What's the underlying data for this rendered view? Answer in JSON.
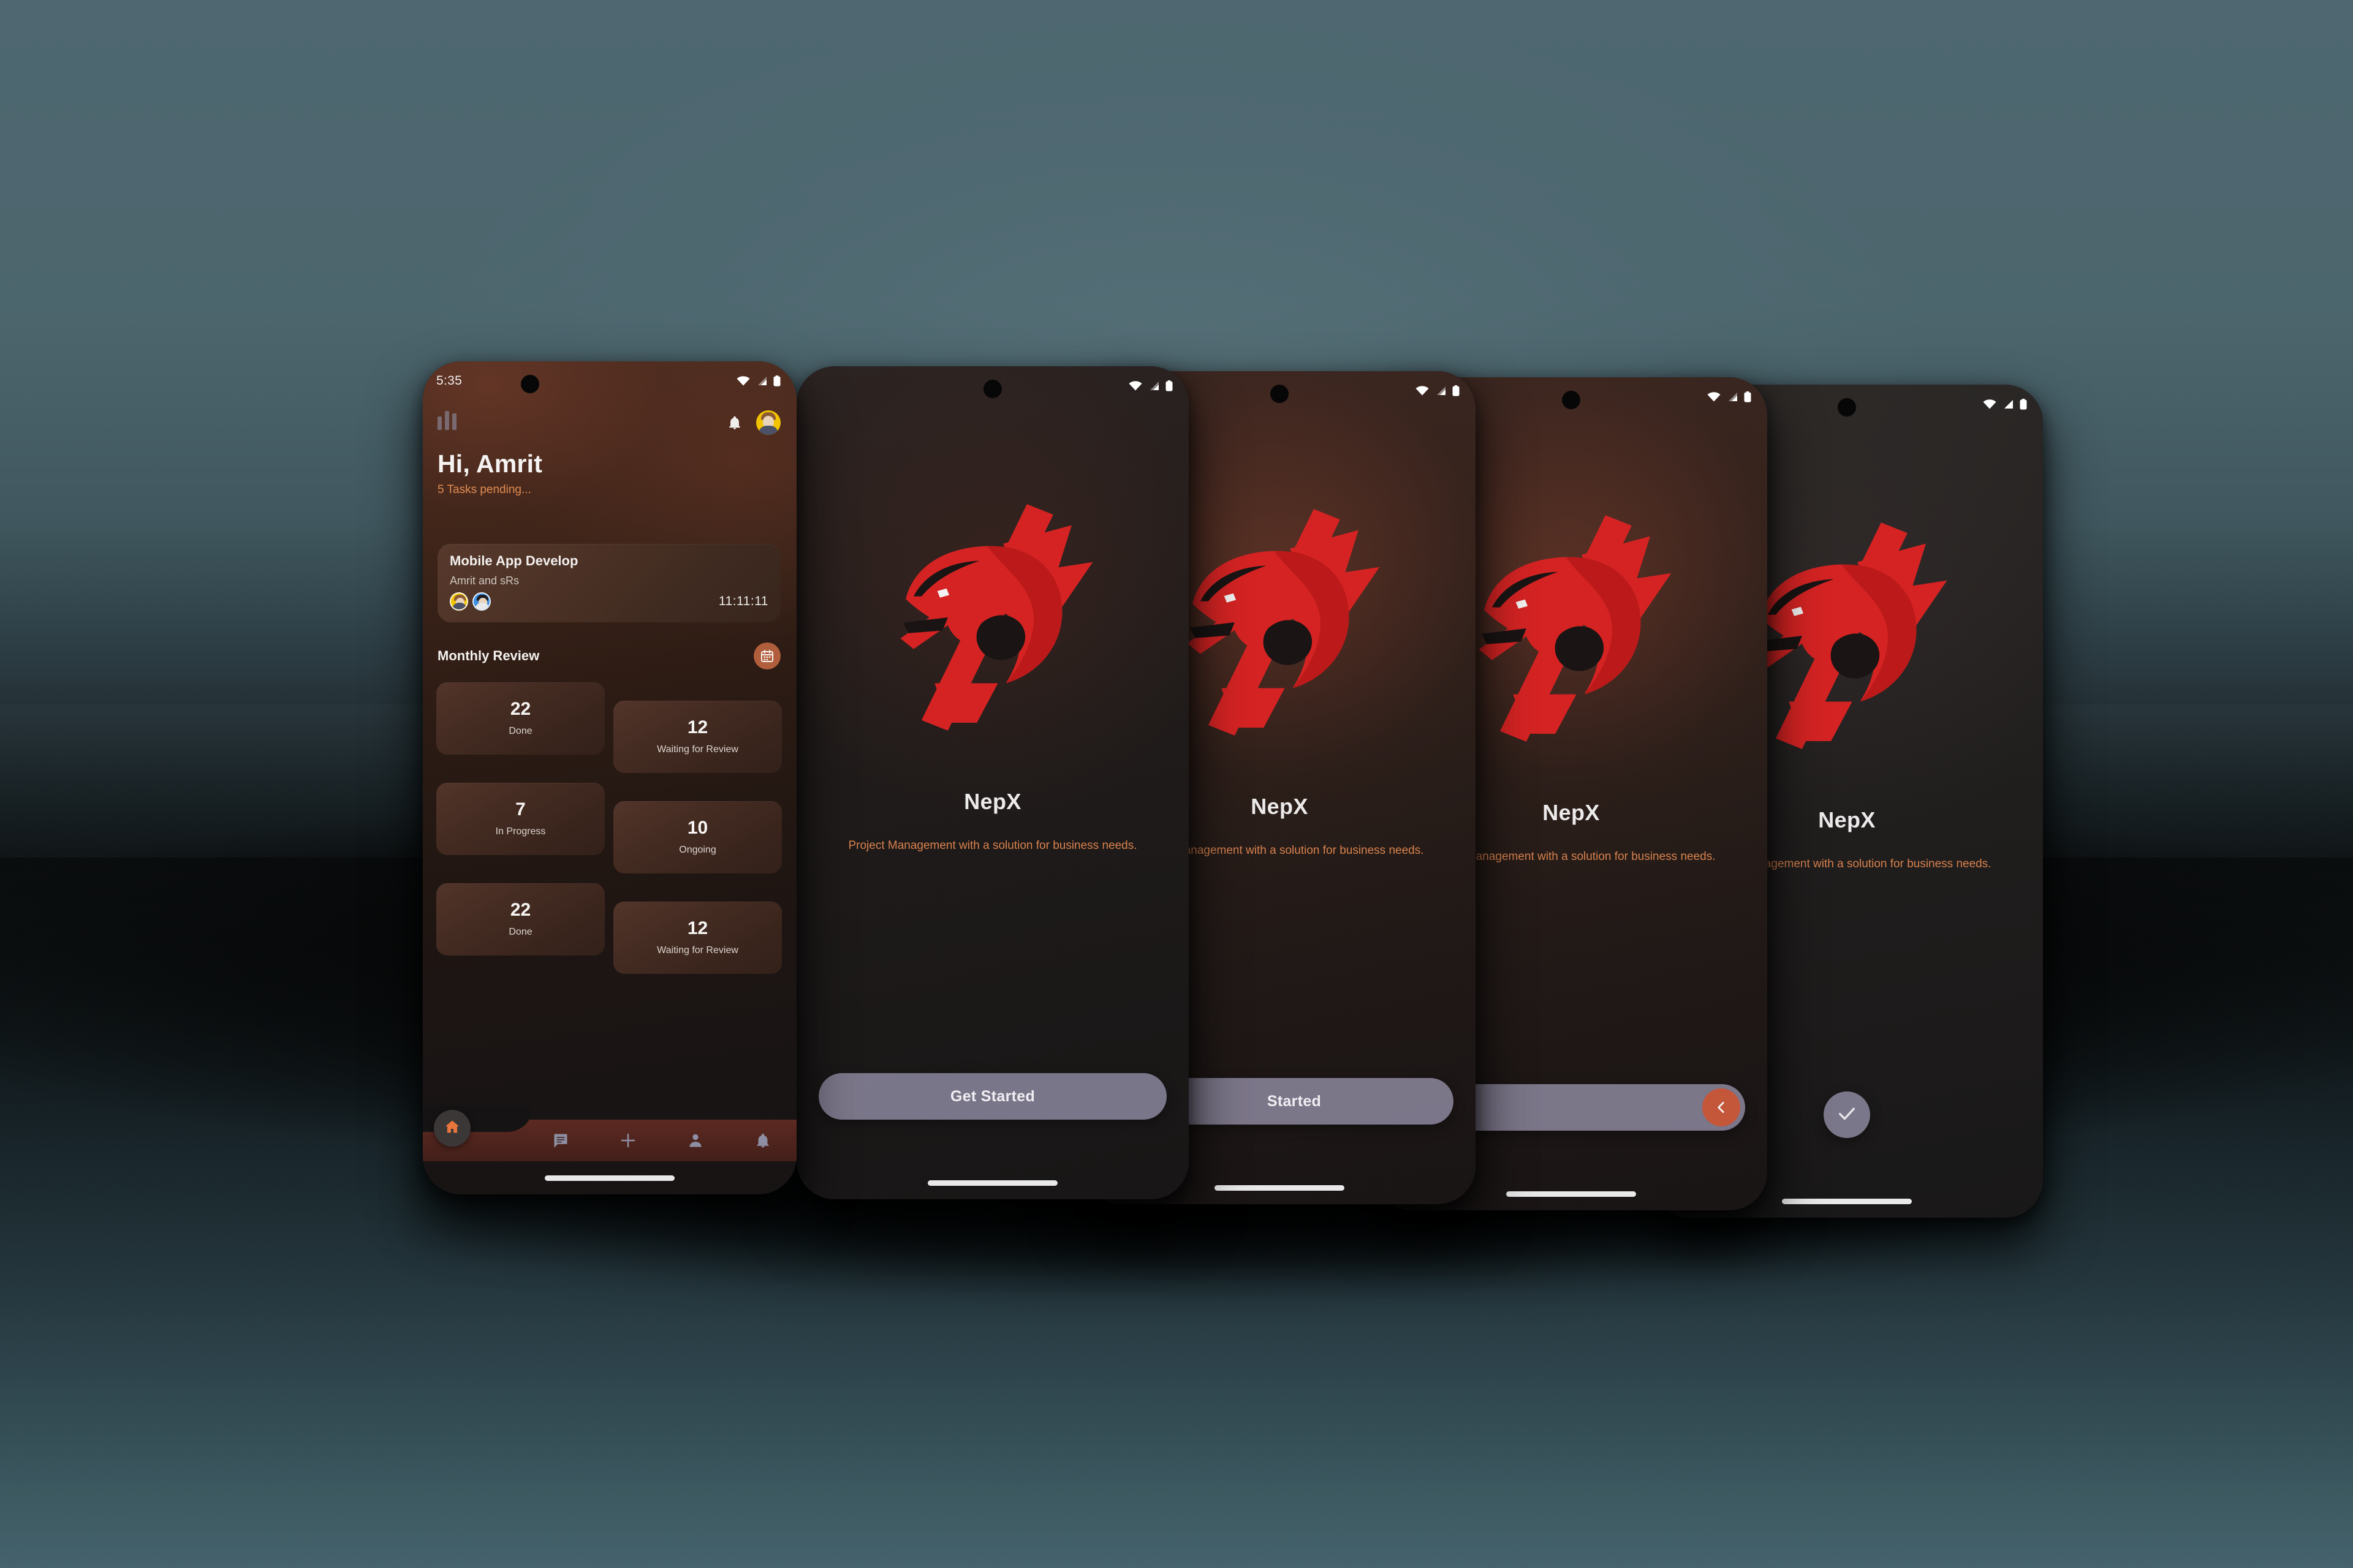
{
  "background": {
    "sky_color": "#4c666e",
    "floor_color": "#3b5860",
    "accent_orange": "#c4563a",
    "brand_red": "#d62121"
  },
  "phones": [
    {
      "id": "dashboard",
      "status": {
        "time": "5:35",
        "wifi_icon": "wifi-icon",
        "signal_icon": "signal-icon",
        "battery_icon": "battery-icon"
      },
      "header": {
        "logo_icon": "bar-chart-logo-icon",
        "bell_icon": "bell-icon",
        "avatar_icon": "user-avatar",
        "greeting": "Hi, Amrit",
        "subtitle": "5 Tasks pending..."
      },
      "project_card": {
        "title": "Mobile App Develop",
        "members": "Amrit and sRs",
        "time": "11:11:11",
        "avatars": [
          "user-avatar-amrit",
          "user-avatar-srs"
        ]
      },
      "section": {
        "title": "Monthly Review",
        "action_icon": "calendar-icon"
      },
      "stats": [
        {
          "value": "22",
          "label": "Done"
        },
        {
          "value": "12",
          "label": "Waiting for Review"
        },
        {
          "value": "7",
          "label": "In Progress"
        },
        {
          "value": "10",
          "label": "Ongoing"
        },
        {
          "value": "22",
          "label": "Done"
        },
        {
          "value": "12",
          "label": "Waiting for Review"
        }
      ],
      "nav": [
        {
          "icon": "home-icon",
          "active": true
        },
        {
          "icon": "chat-icon",
          "active": false
        },
        {
          "icon": "plus-icon",
          "active": false
        },
        {
          "icon": "person-icon",
          "active": false
        },
        {
          "icon": "bell-icon",
          "active": false
        }
      ]
    },
    {
      "id": "onboarding-1",
      "status": {
        "wifi_icon": "wifi-icon",
        "signal_icon": "signal-icon",
        "battery_icon": "battery-icon"
      },
      "logo_icon": "dragon-logo",
      "brand": "NepX",
      "tagline": "Project Management with a solution for business needs.",
      "cta": {
        "label": "Get Started",
        "state": "idle"
      }
    },
    {
      "id": "onboarding-2",
      "status": {
        "wifi_icon": "wifi-icon",
        "signal_icon": "signal-icon",
        "battery_icon": "battery-icon"
      },
      "logo_icon": "dragon-logo",
      "brand": "NepX",
      "tagline": "Project Management with a solution for business needs.",
      "cta": {
        "label": "Started",
        "state": "loading",
        "knob_icon": "spinner-icon"
      }
    },
    {
      "id": "onboarding-3",
      "status": {
        "wifi_icon": "wifi-icon",
        "signal_icon": "signal-icon",
        "battery_icon": "battery-icon"
      },
      "logo_icon": "dragon-logo",
      "brand": "NepX",
      "tagline": "Project Management with a solution for business needs.",
      "cta": {
        "label": "",
        "state": "sliding",
        "knob_icon": "chevron-left-icon"
      }
    },
    {
      "id": "onboarding-4",
      "status": {
        "wifi_icon": "wifi-icon",
        "signal_icon": "signal-icon",
        "battery_icon": "battery-icon"
      },
      "logo_icon": "dragon-logo",
      "brand": "NepX",
      "tagline": "Project Management with a solution for business needs.",
      "cta": {
        "label": "",
        "state": "done",
        "knob_icon": "check-icon"
      }
    }
  ]
}
